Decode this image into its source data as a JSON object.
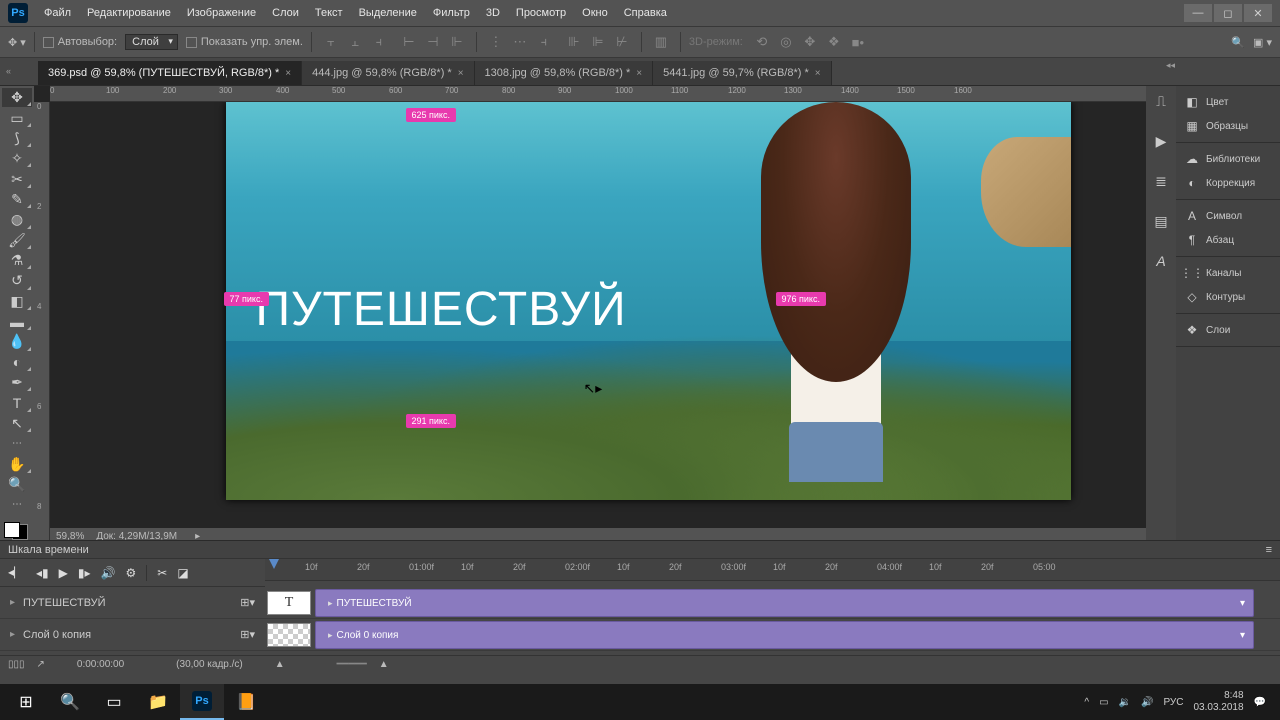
{
  "menu": {
    "items": [
      "Файл",
      "Редактирование",
      "Изображение",
      "Слои",
      "Текст",
      "Выделение",
      "Фильтр",
      "3D",
      "Просмотр",
      "Окно",
      "Справка"
    ]
  },
  "options": {
    "autoselect": "Автовыбор:",
    "layer": "Слой",
    "show_controls": "Показать упр. элем.",
    "mode3d": "3D-режим:"
  },
  "tabs": [
    {
      "label": "369.psd @ 59,8% (ПУТЕШЕСТВУЙ, RGB/8*) *",
      "active": true
    },
    {
      "label": "444.jpg @ 59,8% (RGB/8*) *",
      "active": false
    },
    {
      "label": "1308.jpg @ 59,8% (RGB/8*) *",
      "active": false
    },
    {
      "label": "5441.jpg @ 59,7% (RGB/8*) *",
      "active": false
    }
  ],
  "ruler_h": [
    "0",
    "200",
    "400",
    "600",
    "800",
    "1000",
    "1200",
    "1400",
    "1600"
  ],
  "ruler_h_extra": [
    "100",
    "300",
    "500",
    "700",
    "900",
    "1100",
    "1300",
    "1500"
  ],
  "ruler_v": [
    "0",
    "2",
    "4",
    "6",
    "8"
  ],
  "canvas": {
    "text": "ПУТЕШЕСТВУЙ",
    "tags": {
      "t1": "625 пикс.",
      "t2": "77 пикс.",
      "t3": "291 пикс.",
      "t4": "976 пикс."
    }
  },
  "status": {
    "zoom": "59,8%",
    "doc": "Док: 4,29M/13,9M"
  },
  "panels": {
    "g1": [
      {
        "icon": "◧",
        "label": "Цвет"
      },
      {
        "icon": "▦",
        "label": "Образцы"
      }
    ],
    "g2": [
      {
        "icon": "☁",
        "label": "Библиотеки"
      },
      {
        "icon": "◐",
        "label": "Коррекция"
      }
    ],
    "g3": [
      {
        "icon": "A",
        "label": "Символ"
      },
      {
        "icon": "¶",
        "label": "Абзац"
      }
    ],
    "g4": [
      {
        "icon": "⋮⋮",
        "label": "Каналы"
      },
      {
        "icon": "◇",
        "label": "Контуры"
      }
    ],
    "g5": [
      {
        "icon": "❖",
        "label": "Слои"
      }
    ]
  },
  "timeline": {
    "title": "Шкала времени",
    "ruler": [
      "10f",
      "20f",
      "01:00f",
      "10f",
      "20f",
      "02:00f",
      "10f",
      "20f",
      "03:00f",
      "10f",
      "20f",
      "04:00f",
      "10f",
      "20f",
      "05:00"
    ],
    "tracks": [
      {
        "name": "ПУТЕШЕСТВУЙ",
        "thumb": "T",
        "clip": "ПУТЕШЕСТВУЙ"
      },
      {
        "name": "Слой 0 копия",
        "thumb": "checker",
        "clip": "Слой 0 копия"
      }
    ],
    "time": "0:00:00:00",
    "fps": "(30,00 кадр./с)"
  },
  "taskbar": {
    "lang": "РУС",
    "time": "8:48",
    "date": "03.03.2018"
  }
}
